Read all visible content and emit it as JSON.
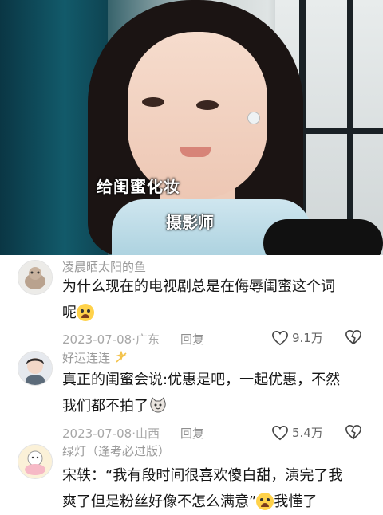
{
  "video": {
    "caption_main": "给闺蜜化妆",
    "caption_sub": "摄影师"
  },
  "comments": [
    {
      "username": "凌晨晒太阳的鱼",
      "text_line1": "为什么现在的电视剧总是在侮辱闺蜜这个词",
      "text_line2": "呢",
      "date": "2023-07-08",
      "location": "广东",
      "reply": "回复",
      "likes": "9.1万"
    },
    {
      "username": "好运连连",
      "text_line1": "真正的闺蜜会说:优惠是吧，一起优惠，不然",
      "text_line2": "我们都不拍了",
      "date": "2023-07-08",
      "location": "山西",
      "reply": "回复",
      "likes": "5.4万"
    },
    {
      "username": "绿灯（逢考必过版）",
      "text_line1": "宋轶：“我有段时间很喜欢傻白甜，演完了我",
      "text_line2_a": "爽了但是粉丝好像不怎么满意”",
      "text_line2_b": "我懂了"
    }
  ],
  "meta_separator": " · "
}
